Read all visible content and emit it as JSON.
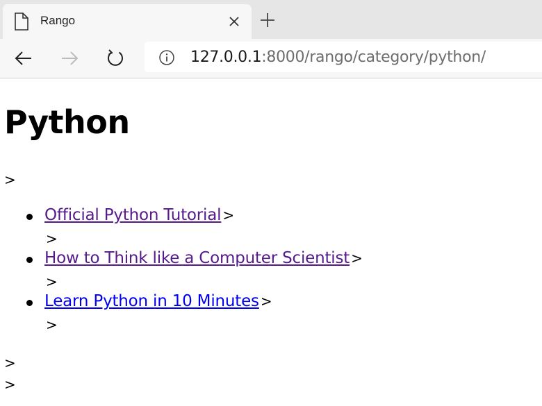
{
  "browser": {
    "tab": {
      "title": "Rango",
      "icon": "page-icon",
      "close_icon": "close-icon"
    },
    "new_tab_icon": "plus-icon",
    "nav": {
      "back_icon": "arrow-left-icon",
      "forward_icon": "arrow-right-icon",
      "reload_icon": "reload-icon"
    },
    "address": {
      "info_icon": "info-icon",
      "url_host": "127.0.0.1",
      "url_rest": ":8000/rango/category/python/"
    }
  },
  "page": {
    "title": "Python",
    "stray_marker": ">",
    "pages": [
      {
        "title": "Official Python Tutorial",
        "after": ">",
        "sub_marker": ">",
        "visited": true
      },
      {
        "title": "How to Think like a Computer Scientist",
        "after": ">",
        "sub_marker": ">",
        "visited": true
      },
      {
        "title": "Learn Python in 10 Minutes",
        "after": ">",
        "sub_marker": ">",
        "visited": false
      }
    ],
    "footer_markers": [
      ">",
      ">"
    ]
  },
  "colors": {
    "visited_link": "#551a8b",
    "unvisited_link": "#0000ee",
    "tabstrip_bg": "#e6e6e6",
    "toolbar_bg": "#f7f7f7"
  }
}
